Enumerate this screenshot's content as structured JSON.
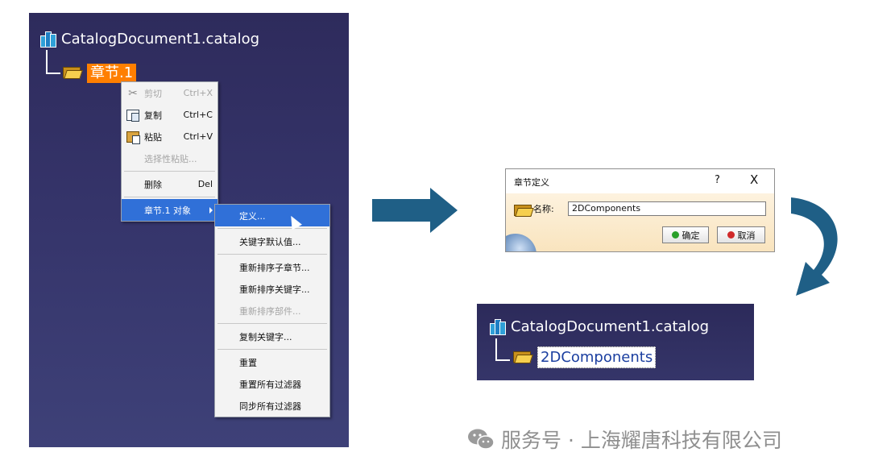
{
  "left_panel": {
    "catalog_name": "CatalogDocument1.catalog",
    "chapter_name": "章节.1"
  },
  "context_menu": {
    "items": [
      {
        "label": "剪切",
        "shortcut": "Ctrl+X",
        "icon": "scissors-icon",
        "enabled": false
      },
      {
        "label": "复制",
        "shortcut": "Ctrl+C",
        "icon": "copy-icon",
        "enabled": true
      },
      {
        "label": "粘贴",
        "shortcut": "Ctrl+V",
        "icon": "paste-icon",
        "enabled": true
      },
      {
        "label": "选择性粘贴...",
        "shortcut": "",
        "enabled": false
      },
      {
        "label": "删除",
        "shortcut": "Del",
        "enabled": true
      },
      {
        "label": "章节.1 对象",
        "shortcut": "",
        "enabled": true,
        "highlighted": true,
        "has_submenu": true
      }
    ]
  },
  "submenu": {
    "items": [
      {
        "label": "定义...",
        "highlighted": true,
        "enabled": true
      },
      {
        "label": "关键字默认值...",
        "enabled": true
      },
      {
        "label": "重新排序子章节...",
        "enabled": true
      },
      {
        "label": "重新排序关键字...",
        "enabled": true
      },
      {
        "label": "重新排序部件...",
        "enabled": false
      },
      {
        "label": "复制关键字...",
        "enabled": true
      },
      {
        "label": "重置",
        "enabled": true
      },
      {
        "label": "重置所有过滤器",
        "enabled": true
      },
      {
        "label": "同步所有过滤器",
        "enabled": true
      }
    ]
  },
  "dialog": {
    "title": "章节定义",
    "help": "?",
    "close": "X",
    "name_label": "名称:",
    "name_value": "2DComponents",
    "ok_label": "确定",
    "cancel_label": "取消"
  },
  "result_panel": {
    "catalog_name": "CatalogDocument1.catalog",
    "chapter_name": "2DComponents"
  },
  "watermark": {
    "text": "服务号 · 上海耀唐科技有限公司"
  },
  "colors": {
    "panel_bg": "#35346a",
    "selection_orange": "#ff7f00",
    "menu_highlight": "#3070d8",
    "arrow": "#1f5f86",
    "ok_green": "#2aa02a",
    "cancel_red": "#d02a2a"
  }
}
